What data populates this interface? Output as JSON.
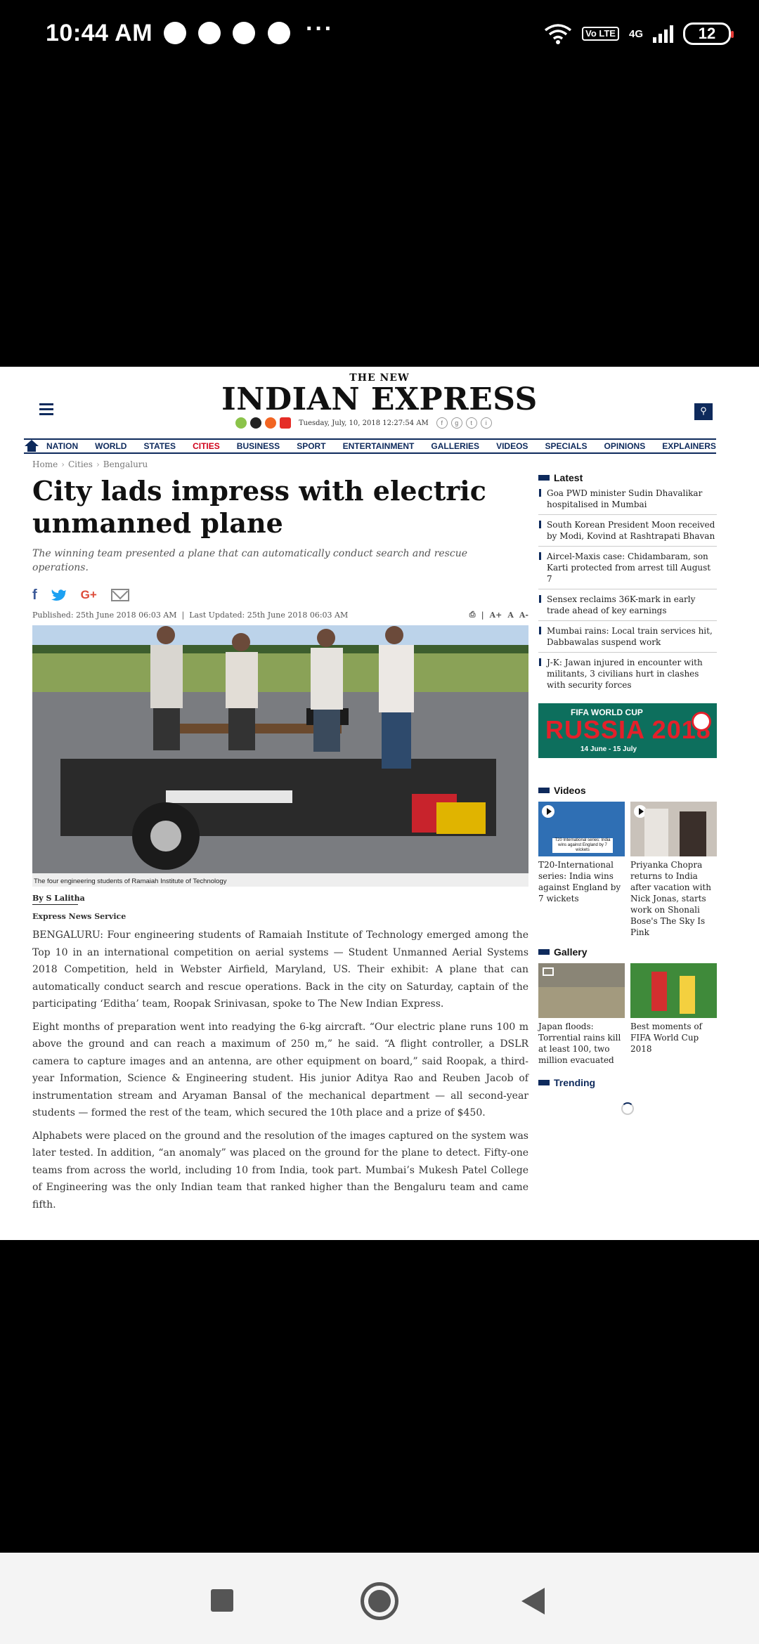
{
  "status_bar": {
    "time": "10:44 AM",
    "notification_icons": [
      "chat-bubble-icon",
      "grid-app-icon",
      "grid-app-icon",
      "facebook-icon"
    ],
    "more": "···",
    "volte": "Vo LTE",
    "network": "4G",
    "battery": "12"
  },
  "site": {
    "logo_top": "THE NEW",
    "logo_main": "INDIAN EXPRESS",
    "date_line": "Tuesday, July, 10, 2018  12:27:54 AM",
    "nav": [
      "NATION",
      "WORLD",
      "STATES",
      "CITIES",
      "BUSINESS",
      "SPORT",
      "ENTERTAINMENT",
      "GALLERIES",
      "VIDEOS",
      "SPECIALS",
      "OPINIONS",
      "EXPLAINERS"
    ],
    "active_nav": "CITIES",
    "colors": {
      "brand": "#0e2a5c",
      "active": "#d0021b"
    }
  },
  "article": {
    "breadcrumb": [
      "Home",
      "Cities",
      "Bengaluru"
    ],
    "title": "City lads impress with electric unmanned plane",
    "subtitle": "The winning team presented a plane that can automatically conduct search and rescue operations.",
    "published": "Published: 25th June 2018 06:03 AM",
    "updated": "Last Updated: 25th June 2018 06:03 AM",
    "font_controls": [
      "A+",
      "A",
      "A-"
    ],
    "caption": "The four engineering students of Ramaiah Institute of Technology",
    "byline": "By S Lalitha",
    "source": "Express News Service",
    "paragraphs": [
      "BENGALURU: Four engineering students of Ramaiah Institute of Technology emerged among the Top 10 in an international competition on aerial systems — Student Unmanned Aerial Systems 2018 Competition, held in Webster Airfield, Maryland, US. Their exhibit: A plane that can automatically conduct search and rescue operations. Back in the city on Saturday, captain of the participating ‘Editha’ team, Roopak Srinivasan, spoke to The New Indian Express.",
      "Eight months of preparation went into readying the 6-kg aircraft. “Our electric plane runs 100 m above the ground and can reach a maximum of 250 m,” he said. “A flight controller, a DSLR camera to capture images and an antenna, are other equipment on board,” said Roopak, a third-year Information, Science & Engineering student. His junior Aditya Rao and Reuben Jacob of instrumentation stream and Aryaman Bansal of the mechanical department — all second-year students — formed the rest of the team, which secured the 10th place and a prize of $450.",
      "Alphabets were placed on the ground and the resolution of the images captured on the system was later tested. In addition, “an anomaly” was placed on the ground for the plane to detect. Fifty-one teams from across the world, including 10 from India, took part. Mumbai’s  Mukesh Patel College of Engineering was the only Indian team that ranked higher than the Bengaluru team and came fifth."
    ]
  },
  "sidebar": {
    "latest_title": "Latest",
    "latest": [
      "Goa PWD minister Sudin Dhavalikar hospitalised in Mumbai",
      "South Korean President Moon received by Modi, Kovind at Rashtrapati Bhavan",
      "Aircel-Maxis case: Chidambaram, son Karti protected from arrest till August 7",
      "Sensex reclaims 36K-mark in early trade ahead of key earnings",
      "Mumbai rains: Local train services hit, Dabbawalas suspend work",
      "J-K: Jawan injured in encounter with militants, 3 civilians hurt in clashes with security forces"
    ],
    "banner": {
      "top": "FIFA WORLD CUP",
      "main": "RUSSIA 2018",
      "dates": "14 June - 15 July"
    },
    "videos_title": "Videos",
    "videos": [
      {
        "title": "T20-International series: India wins against England by 7 wickets",
        "thumb_text": "T20 International series: India wins against England by 7 wickets"
      },
      {
        "title": "Priyanka Chopra returns to India after vacation with Nick Jonas, starts work on Shonali Bose's The Sky Is Pink"
      }
    ],
    "gallery_title": "Gallery",
    "gallery": [
      "Japan floods: Torrential rains kill at least 100, two million evacuated",
      "Best moments of FIFA World Cup 2018"
    ],
    "trending_title": "Trending"
  }
}
